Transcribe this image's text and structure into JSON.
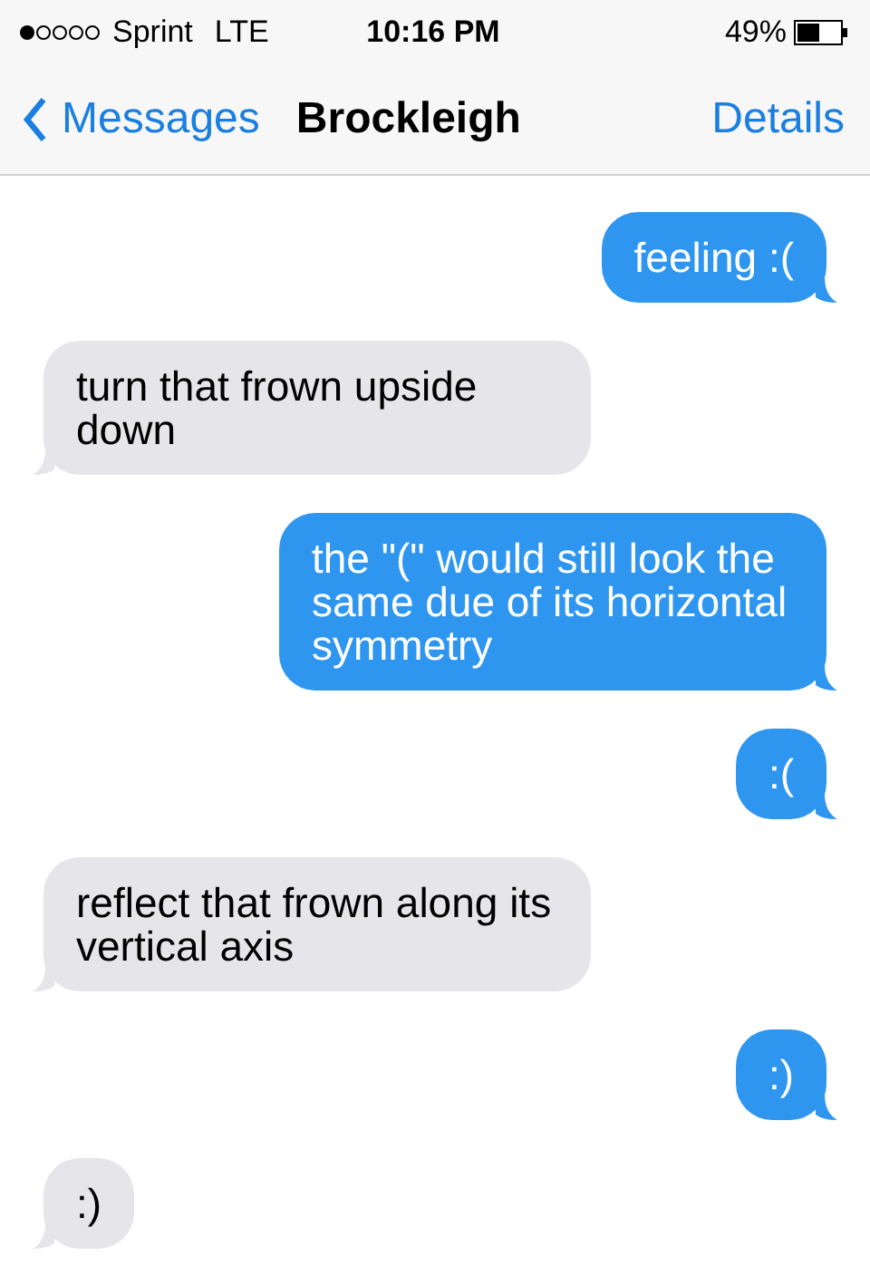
{
  "status_bar": {
    "carrier": "Sprint",
    "network": "LTE",
    "time": "10:16 PM",
    "battery": "49%"
  },
  "nav_bar": {
    "back": "Messages",
    "title": "Brockleigh",
    "action": "Details"
  },
  "messages": [
    {
      "kind": "sent",
      "text": "feeling :("
    },
    {
      "kind": "received",
      "text": "turn that frown upside down"
    },
    {
      "kind": "sent",
      "text": "the \"(\" would still look the same due of its horizontal symmetry"
    },
    {
      "kind": "sent",
      "text": ":("
    },
    {
      "kind": "received",
      "text": "reflect that frown along its vertical axis"
    },
    {
      "kind": "sent",
      "text": ":)"
    },
    {
      "kind": "received",
      "text": ":)"
    }
  ]
}
